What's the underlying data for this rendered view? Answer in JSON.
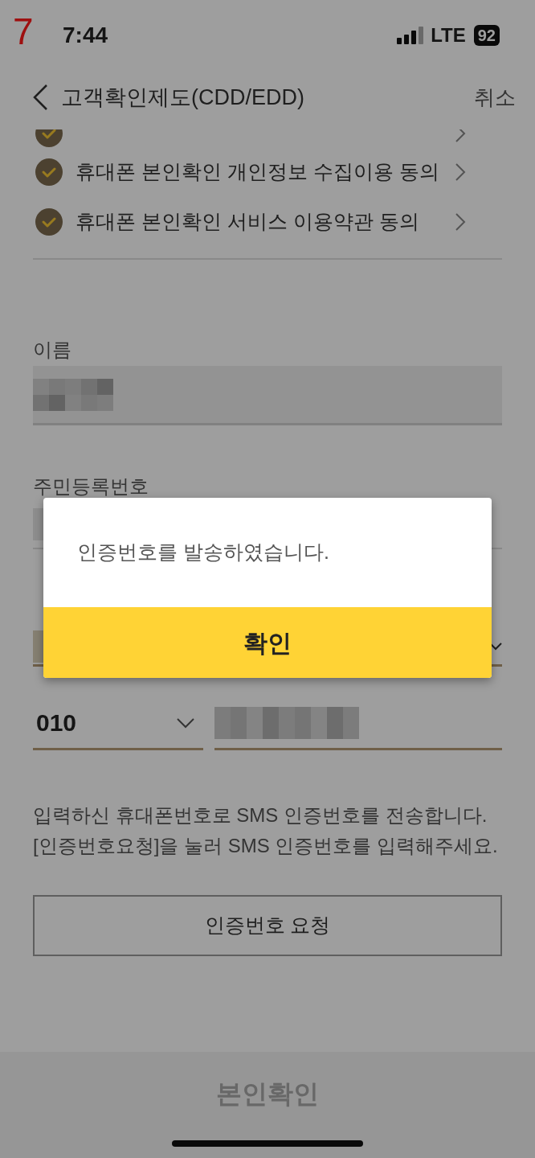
{
  "annotation": "7",
  "status_bar": {
    "time": "7:44",
    "network": "LTE",
    "battery": "92"
  },
  "header": {
    "title": "고객확인제도(CDD/EDD)",
    "cancel": "취소"
  },
  "agreements": [
    {
      "kind": "partial",
      "checked": true
    },
    {
      "kind": "full",
      "label": "휴대폰 본인확인 개인정보 수집이용 동의",
      "checked": true
    },
    {
      "kind": "full",
      "label": "휴대폰 본인확인 서비스 이용약관 동의",
      "checked": true
    }
  ],
  "form": {
    "name_label": "이름",
    "id_label": "주민등록번호",
    "carrier": "010"
  },
  "help_text": "입력하신 휴대폰번호로 SMS 인증번호를 전송합니다. [인증번호요청]을 눌러 SMS 인증번호를 입력해주세요.",
  "request_button": "인증번호 요청",
  "bottom_button": {
    "label": "본인확인",
    "disabled": true
  },
  "dialog": {
    "message": "인증번호를 발송하였습니다.",
    "confirm": "확인"
  }
}
